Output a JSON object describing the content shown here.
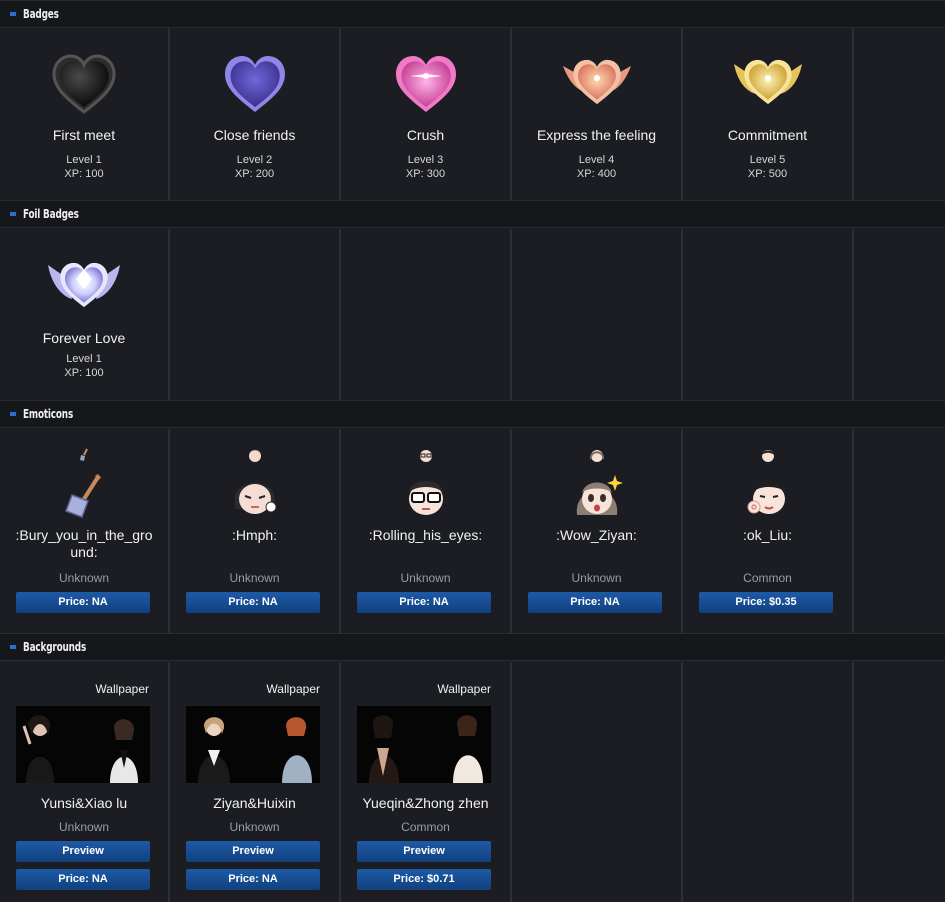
{
  "sections": {
    "badges": "Badges",
    "foil_badges": "Foil Badges",
    "emoticons": "Emoticons",
    "backgrounds": "Backgrounds"
  },
  "badges": [
    {
      "name": "First meet",
      "level": "Level 1",
      "xp": "XP: 100",
      "icon": "black-heart-badge-icon"
    },
    {
      "name": "Close friends",
      "level": "Level 2",
      "xp": "XP: 200",
      "icon": "purple-heart-badge-icon"
    },
    {
      "name": "Crush",
      "level": "Level 3",
      "xp": "XP: 300",
      "icon": "pink-heart-badge-icon"
    },
    {
      "name": "Express the feeling",
      "level": "Level 4",
      "xp": "XP: 400",
      "icon": "rose-winged-heart-badge-icon"
    },
    {
      "name": "Commitment",
      "level": "Level 5",
      "xp": "XP: 500",
      "icon": "gold-winged-heart-badge-icon"
    }
  ],
  "foil_badges": [
    {
      "name": "Forever Love",
      "level": "Level 1",
      "xp": "XP: 100",
      "icon": "silver-winged-heart-badge-icon"
    }
  ],
  "emoticons": [
    {
      "name": ":Bury_you_in_the_ground:",
      "name_line1": ":Bury_you_in_the_gro",
      "name_line2": "und:",
      "rarity": "Unknown",
      "price": "Price: NA",
      "icon": "shovel-icon"
    },
    {
      "name": ":Hmph:",
      "rarity": "Unknown",
      "price": "Price: NA",
      "icon": "hmph-face-icon"
    },
    {
      "name": ":Rolling_his_eyes:",
      "rarity": "Unknown",
      "price": "Price: NA",
      "icon": "glasses-face-icon"
    },
    {
      "name": ":Wow_Ziyan:",
      "rarity": "Unknown",
      "price": "Price: NA",
      "icon": "wow-face-icon"
    },
    {
      "name": ":ok_Liu:",
      "rarity": "Common",
      "price": "Price: $0.35",
      "icon": "ok-face-icon"
    }
  ],
  "backgrounds": [
    {
      "label": "Wallpaper",
      "name": "Yunsi&Xiao lu",
      "rarity": "Unknown",
      "preview": "Preview",
      "price": "Price: NA"
    },
    {
      "label": "Wallpaper",
      "name": "Ziyan&Huixin",
      "rarity": "Unknown",
      "preview": "Preview",
      "price": "Price: NA"
    },
    {
      "label": "Wallpaper",
      "name": "Yueqin&Zhong zhen",
      "rarity": "Common",
      "preview": "Preview",
      "price": "Price: $0.71"
    }
  ],
  "colors": {
    "background": "#1b1d22",
    "header": "#15171b",
    "accent": "#2a6fd1",
    "button": "#1d5aa6"
  }
}
